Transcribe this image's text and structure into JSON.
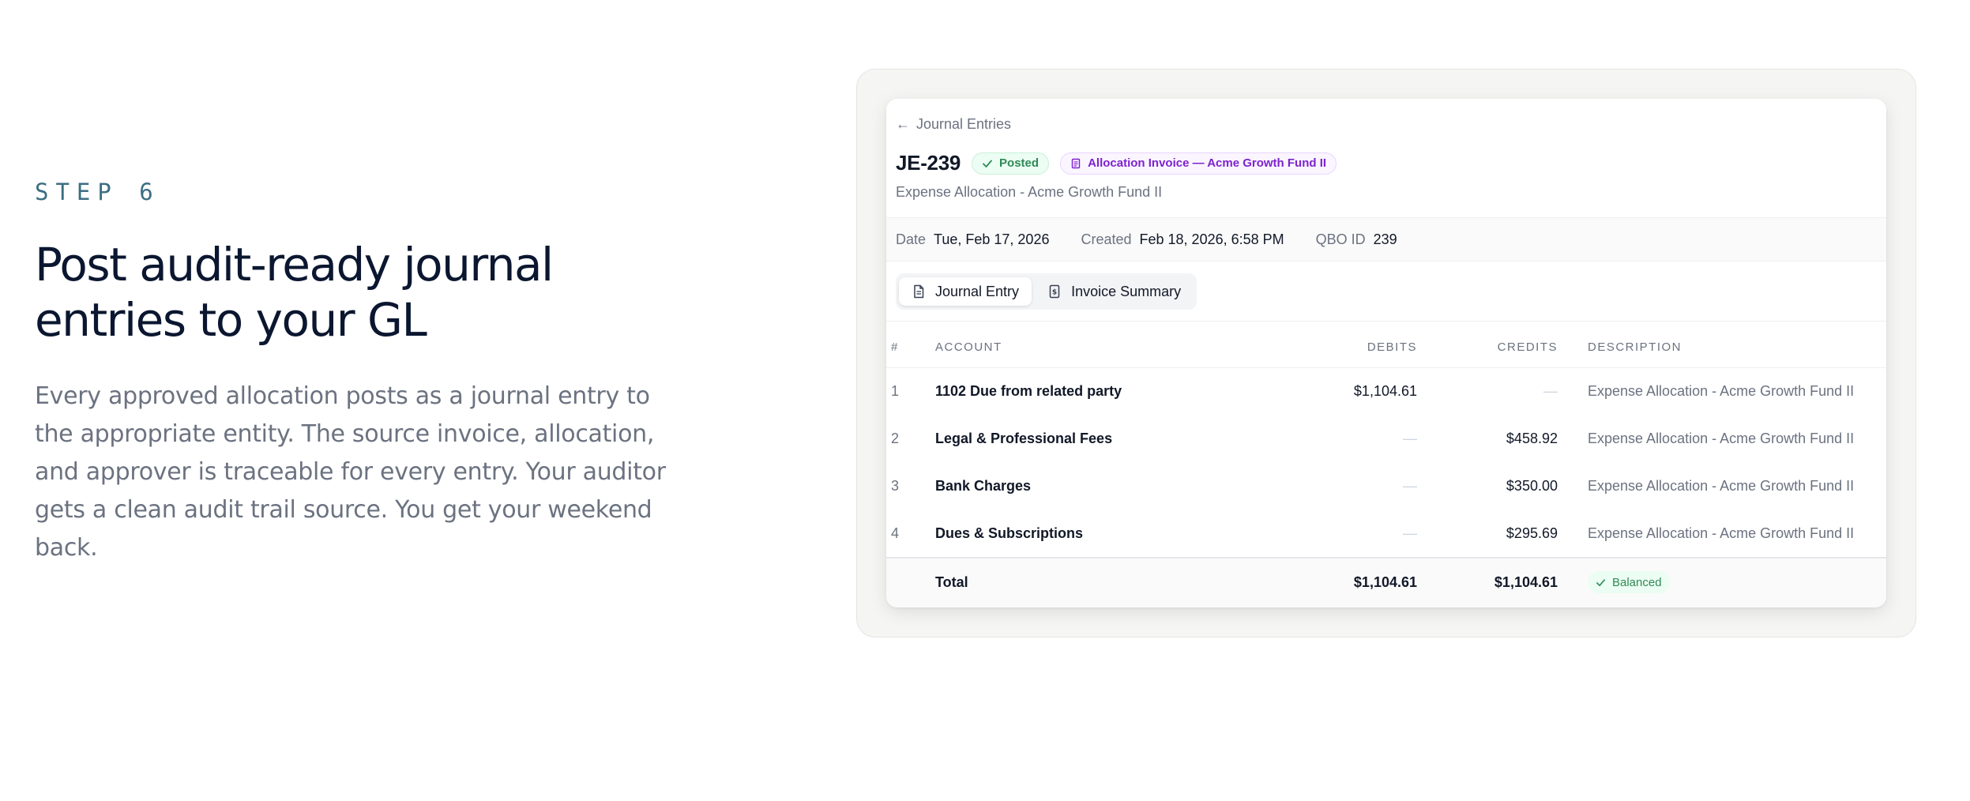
{
  "copy": {
    "step": "STEP 6",
    "headline_line1": "Post audit-ready journal",
    "headline_line2": "entries to your GL",
    "body": "Every approved allocation posts as a journal entry to the appropriate entity. The source invoice, allocation, and approver is traceable for every entry. Your auditor gets a clean audit trail source. You get your weekend back."
  },
  "app": {
    "back_label": "Journal Entries",
    "je_id": "JE-239",
    "status_badge": "Posted",
    "invoice_badge": "Allocation Invoice — Acme Growth Fund II",
    "subtitle": "Expense Allocation - Acme Growth Fund II",
    "meta": {
      "date_label": "Date",
      "date_value": "Tue, Feb 17, 2026",
      "created_label": "Created",
      "created_value": "Feb 18, 2026, 6:58 PM",
      "qbo_label": "QBO ID",
      "qbo_value": "239"
    },
    "tabs": [
      {
        "label": "Journal Entry",
        "icon": "document-icon",
        "active": true
      },
      {
        "label": "Invoice Summary",
        "icon": "receipt-icon",
        "active": false
      }
    ],
    "table": {
      "headers": [
        "#",
        "ACCOUNT",
        "DEBITS",
        "CREDITS",
        "DESCRIPTION"
      ],
      "rows": [
        {
          "num": "1",
          "account": "1102 Due from related party",
          "debit": "$1,104.61",
          "credit": "—",
          "description": "Expense Allocation - Acme Growth Fund II"
        },
        {
          "num": "2",
          "account": "Legal & Professional Fees",
          "debit": "—",
          "credit": "$458.92",
          "description": "Expense Allocation - Acme Growth Fund II"
        },
        {
          "num": "3",
          "account": "Bank Charges",
          "debit": "—",
          "credit": "$350.00",
          "description": "Expense Allocation - Acme Growth Fund II"
        },
        {
          "num": "4",
          "account": "Dues & Subscriptions",
          "debit": "—",
          "credit": "$295.69",
          "description": "Expense Allocation - Acme Growth Fund II"
        }
      ],
      "total": {
        "label": "Total",
        "debit": "$1,104.61",
        "credit": "$1,104.61",
        "status": "Balanced"
      }
    }
  },
  "colors": {
    "posted_green": "#2f8a55",
    "invoice_purple": "#7e22ce",
    "step_teal": "#3b6e82",
    "headline_navy": "#0b1730"
  }
}
